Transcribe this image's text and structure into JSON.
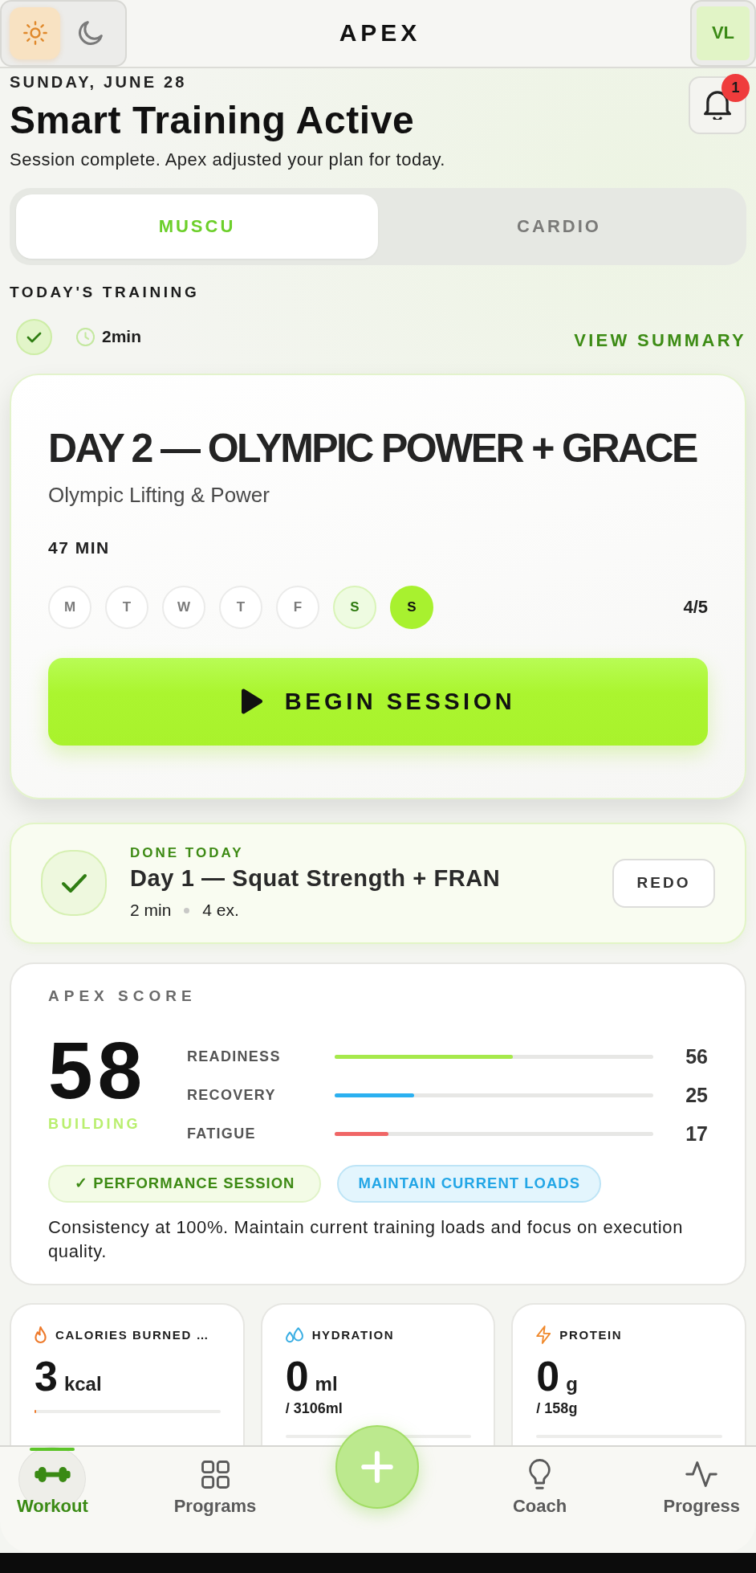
{
  "header": {
    "title": "APEX",
    "theme_options": [
      {
        "kind": "sun",
        "selected": true
      },
      {
        "kind": "moon",
        "selected": false
      }
    ],
    "avatar_initials": "VL"
  },
  "hero": {
    "date": "SUNDAY, JUNE 28",
    "title": "Smart Training Active",
    "subtitle": "Session complete. Apex adjusted your plan for today.",
    "notification_count": "1"
  },
  "tabs": [
    {
      "label": "MUSCU",
      "selected": true
    },
    {
      "label": "CARDIO",
      "selected": false
    }
  ],
  "today": {
    "heading": "TODAY'S TRAINING",
    "duration": "2min",
    "link": "VIEW SUMMARY"
  },
  "session": {
    "title": "DAY 2 — OLYMPIC POWER + GRACE",
    "subtitle": "Olympic Lifting & Power",
    "duration": "47 MIN",
    "days": [
      {
        "label": "M",
        "completed": false,
        "selected": false
      },
      {
        "label": "T",
        "completed": false,
        "selected": false
      },
      {
        "label": "W",
        "completed": false,
        "selected": false
      },
      {
        "label": "T",
        "completed": false,
        "selected": false
      },
      {
        "label": "F",
        "completed": false,
        "selected": false
      },
      {
        "label": "S",
        "completed": true,
        "selected": false
      },
      {
        "label": "S",
        "completed": false,
        "selected": true
      }
    ],
    "progress": "4/5",
    "button": "BEGIN SESSION"
  },
  "done_today": {
    "label": "DONE TODAY",
    "title": "Day 1 — Squat Strength + FRAN",
    "meta": [
      "2 min",
      "4 ex."
    ],
    "button": "REDO"
  },
  "score": {
    "heading": "APEX SCORE",
    "value": "58",
    "status": "BUILDING",
    "metrics": [
      {
        "label": "READINESS",
        "level": 0.56,
        "value": "56",
        "color": "#a6e94b"
      },
      {
        "label": "RECOVERY",
        "level": 0.25,
        "value": "25",
        "color": "#2bb0f0"
      },
      {
        "label": "FATIGUE",
        "level": 0.17,
        "value": "17",
        "color": "#f06666"
      }
    ],
    "tags": [
      {
        "kind": "performance",
        "label": "✓ PERFORMANCE SESSION"
      },
      {
        "kind": "advice",
        "label": "MAINTAIN CURRENT LOADS"
      }
    ],
    "note": "Consistency at 100%. Maintain current training loads and focus on execution quality."
  },
  "stats": [
    {
      "kind": "calories",
      "label": "CALORIES BURNED …",
      "value": "3",
      "unit": "kcal",
      "level": 0.01
    },
    {
      "kind": "hydration",
      "label": "HYDRATION",
      "value": "0",
      "unit": "ml",
      "target": "/ 3106ml"
    },
    {
      "kind": "protein",
      "label": "PROTEIN",
      "value": "0",
      "unit": "g",
      "target": "/ 158g"
    }
  ],
  "nav": {
    "items": [
      {
        "kind": "workout",
        "label": "Workout",
        "selected": true
      },
      {
        "kind": "programs",
        "label": "Programs",
        "selected": false
      },
      {
        "kind": "add"
      },
      {
        "kind": "coach",
        "label": "Coach",
        "selected": false
      },
      {
        "kind": "progress",
        "label": "Progress",
        "selected": false
      }
    ]
  }
}
